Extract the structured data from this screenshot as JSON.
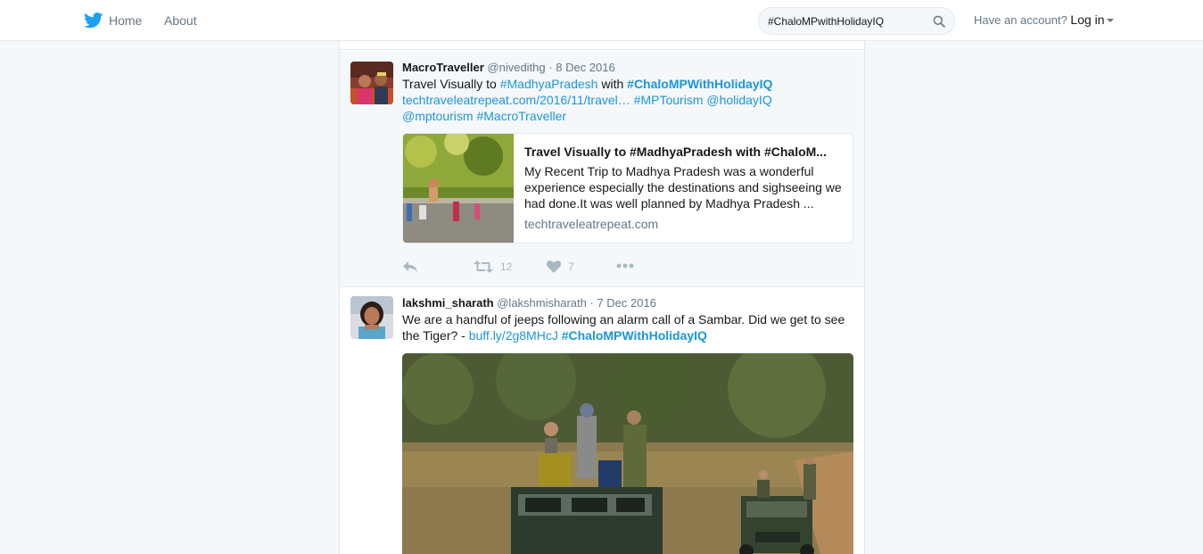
{
  "nav": {
    "home_label": "Home",
    "about_label": "About"
  },
  "search": {
    "value": "#ChaloMPwithHolidayIQ"
  },
  "account": {
    "prompt": "Have an account?",
    "login_label": "Log in"
  },
  "tweets": [
    {
      "name": "MacroTraveller",
      "handle": "@nivedithg",
      "date": "8 Dec 2016",
      "text_plain_1": "Travel Visually to ",
      "hashtag_1": "#MadhyaPradesh",
      "text_plain_2": " with ",
      "hashtag_2": "#ChaloMPWithHolidayIQ",
      "url": "techtraveleatrepeat.com/2016/11/travel…",
      "hashtag_3": "#MPTourism",
      "mention_1": "@holidayIQ",
      "mention_2": "@mptourism",
      "hashtag_4": "#MacroTraveller",
      "card": {
        "title": "Travel Visually to #MadhyaPradesh with #ChaloM...",
        "description": "My Recent Trip to Madhya Pradesh was a wonderful experience especially the destinations and sighseeing we had done.It was well planned by Madhya Pradesh ...",
        "domain": "techtraveleatrepeat.com"
      },
      "retweets": "12",
      "likes": "7"
    },
    {
      "name": "lakshmi_sharath",
      "handle": "@lakshmisharath",
      "date": "7 Dec 2016",
      "text_plain_1": "We are a handful of jeeps following an alarm call of a Sambar. Did we get to see the Tiger? - ",
      "url": "buff.ly/2g8MHcJ",
      "hashtag_1": "#ChaloMPWithHolidayIQ"
    }
  ],
  "colors": {
    "link": "#1b95e0",
    "twitter_blue": "#1da1f2",
    "muted": "#657786"
  },
  "icons": [
    "twitter-bird-icon",
    "search-icon",
    "caret-down-icon",
    "reply-icon",
    "retweet-icon",
    "heart-icon",
    "more-icon"
  ]
}
